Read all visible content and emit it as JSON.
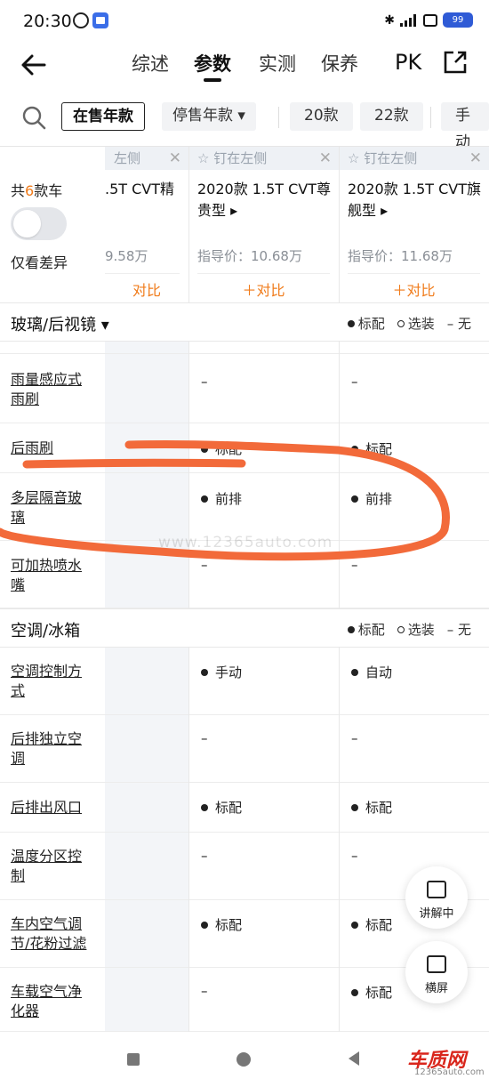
{
  "status": {
    "time": "20:30",
    "battery": "99"
  },
  "nav": {
    "tabs": [
      "综述",
      "参数",
      "实测",
      "保养"
    ],
    "active_tab": "参数",
    "pk_label": "PK"
  },
  "filters": {
    "on_sale": "在售年款",
    "stopped": "停售年款 ▾",
    "y20": "20款",
    "y22": "22款",
    "manual": "手动"
  },
  "header": {
    "total_prefix": "共",
    "total_count": "6",
    "total_suffix": "款车",
    "diff_label": "仅看差异"
  },
  "cars": [
    {
      "pin": "左侧",
      "name": ".5T CVT精",
      "price": "9.58万",
      "compare": "对比"
    },
    {
      "pin": "钉在左侧",
      "name": "2020款 1.5T CVT尊贵型 ▸",
      "price": "指导价：10.68万",
      "compare": "＋对比"
    },
    {
      "pin": "钉在左侧",
      "name": "2020款 1.5T CVT旗舰型 ▸",
      "price": "指导价：11.68万",
      "compare": "＋对比"
    }
  ],
  "legend": {
    "std": "标配",
    "opt": "选装",
    "none": "– 无"
  },
  "sections": [
    {
      "title": "玻璃/后视镜 ▾",
      "rows": [
        {
          "label": "雨量感应式雨刷",
          "v1": "–",
          "v2": "–",
          "d1": false,
          "d2": false
        },
        {
          "label": "后雨刷",
          "v1": "标配",
          "v2": "标配",
          "d1": true,
          "d2": true
        },
        {
          "label": "多层隔音玻璃",
          "v1": "前排",
          "v2": "前排",
          "d1": true,
          "d2": true
        },
        {
          "label": "可加热喷水嘴",
          "v1": "–",
          "v2": "–",
          "d1": false,
          "d2": false
        }
      ]
    },
    {
      "title": "空调/冰箱",
      "rows": [
        {
          "label": "空调控制方式",
          "v1": "手动",
          "v2": "自动",
          "d1": true,
          "d2": true
        },
        {
          "label": "后排独立空调",
          "v1": "–",
          "v2": "–",
          "d1": false,
          "d2": false
        },
        {
          "label": "后排出风口",
          "v1": "标配",
          "v2": "标配",
          "d1": true,
          "d2": true
        },
        {
          "label": "温度分区控制",
          "v1": "–",
          "v2": "–",
          "d1": false,
          "d2": false
        },
        {
          "label": "车内空气调节/花粉过滤",
          "v1": "标配",
          "v2": "标配",
          "d1": true,
          "d2": true
        },
        {
          "label": "车载空气净化器",
          "v1": "–",
          "v2": "标配",
          "d1": false,
          "d2": true
        }
      ]
    }
  ],
  "watermark": "www.12365auto.com",
  "float": {
    "explain": "讲解中",
    "landscape": "横屏"
  },
  "brand": {
    "logo": "车质网",
    "url": "12365auto.com"
  },
  "colors": {
    "accent": "#f07b1a",
    "annotation": "#f26a3a"
  }
}
